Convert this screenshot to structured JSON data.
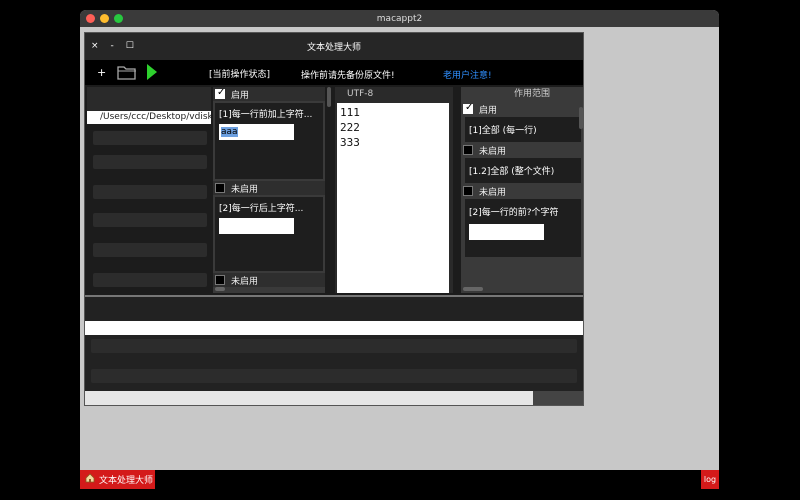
{
  "window": {
    "title": "macappt2"
  },
  "app": {
    "title": "文本处理大师",
    "controls": {
      "close": "×",
      "minimize": "-",
      "maximize": "☐"
    }
  },
  "toolbar": {
    "add": "+",
    "status": "[当前操作状态]",
    "warning": "操作前请先备份原文件!",
    "notice": "老用户注意!",
    "notice_color": "#2f8fff",
    "run_color": "#2ed12e"
  },
  "files": {
    "path": "/Users/ccc/Desktop/vdisk20"
  },
  "rules": {
    "items": [
      {
        "state": "启用",
        "checked": true,
        "title": "[1]每一行前加上字符...",
        "value": "aaa"
      },
      {
        "state": "未启用",
        "checked": false,
        "title": "[2]每一行后上字符...",
        "value": ""
      },
      {
        "state": "未启用",
        "checked": false
      }
    ]
  },
  "encoding": {
    "label": "UTF-8",
    "lines": [
      "111",
      "222",
      "333"
    ]
  },
  "scope": {
    "header": "作用范围",
    "items": [
      {
        "state": "启用",
        "checked": true,
        "option": "[1]全部 (每一行)"
      },
      {
        "state": "未启用",
        "checked": false,
        "option": "[1.2]全部 (整个文件)"
      },
      {
        "state": "未启用",
        "checked": false,
        "option": "[2]每一行的前?个字符"
      }
    ]
  },
  "progress": {
    "fraction": 0.9
  },
  "taskbar": {
    "app_label": "文本处理大师",
    "log_label": "log"
  }
}
